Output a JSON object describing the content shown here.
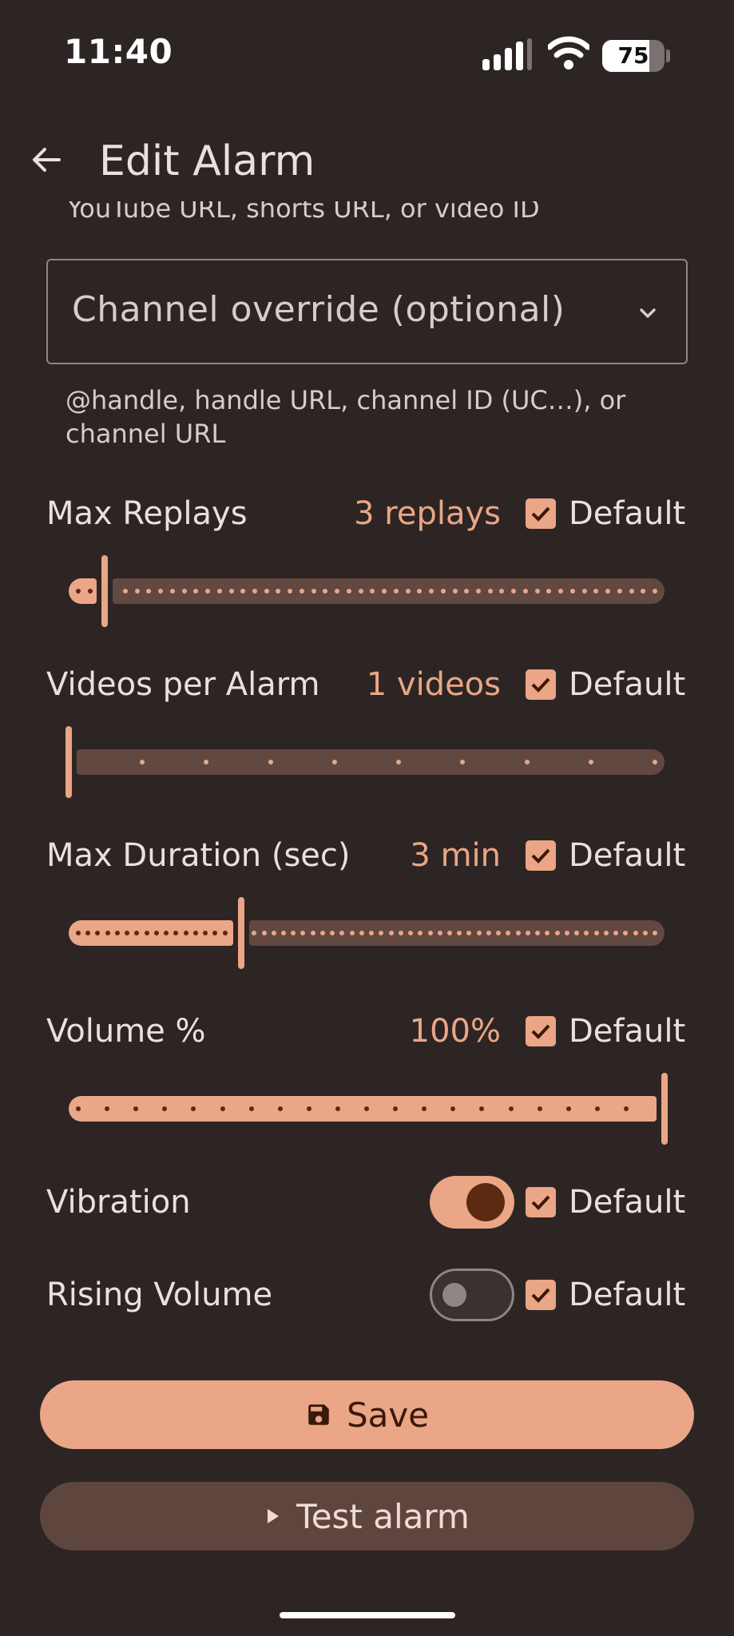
{
  "status_bar": {
    "time": "11:40",
    "battery": "75",
    "battery_level": 0.75
  },
  "app_bar": {
    "title": "Edit Alarm",
    "back_icon": "arrow-left-icon"
  },
  "video_field": {
    "helper": "YouTube URL, shorts URL, or video ID"
  },
  "channel_field": {
    "placeholder": "Channel override (optional)",
    "helper": "@handle, handle URL, channel ID (UC…), or channel URL",
    "icon": "chevron-down-icon"
  },
  "settings": {
    "max_replays": {
      "label": "Max Replays",
      "value": "3 replays",
      "default_label": "Default",
      "default_checked": true,
      "slider_fraction": 0.06
    },
    "videos_per_alarm": {
      "label": "Videos per Alarm",
      "value": "1 videos",
      "default_label": "Default",
      "default_checked": true,
      "slider_fraction": 0.0
    },
    "max_duration": {
      "label": "Max Duration (sec)",
      "value": "3 min",
      "default_label": "Default",
      "default_checked": true,
      "slider_fraction": 0.29
    },
    "volume": {
      "label": "Volume %",
      "value": "100%",
      "default_label": "Default",
      "default_checked": true,
      "slider_fraction": 1.0
    },
    "vibration": {
      "label": "Vibration",
      "enabled": true,
      "default_label": "Default",
      "default_checked": true
    },
    "rising_volume": {
      "label": "Rising Volume",
      "enabled": false,
      "default_label": "Default",
      "default_checked": true
    }
  },
  "actions": {
    "save": {
      "label": "Save",
      "icon": "save-icon"
    },
    "test": {
      "label": "Test alarm",
      "icon": "play-icon"
    }
  },
  "colors": {
    "background": "#2d2523",
    "accent": "#eaa686",
    "track_inactive": "#614840",
    "text": "#ece0dc"
  }
}
